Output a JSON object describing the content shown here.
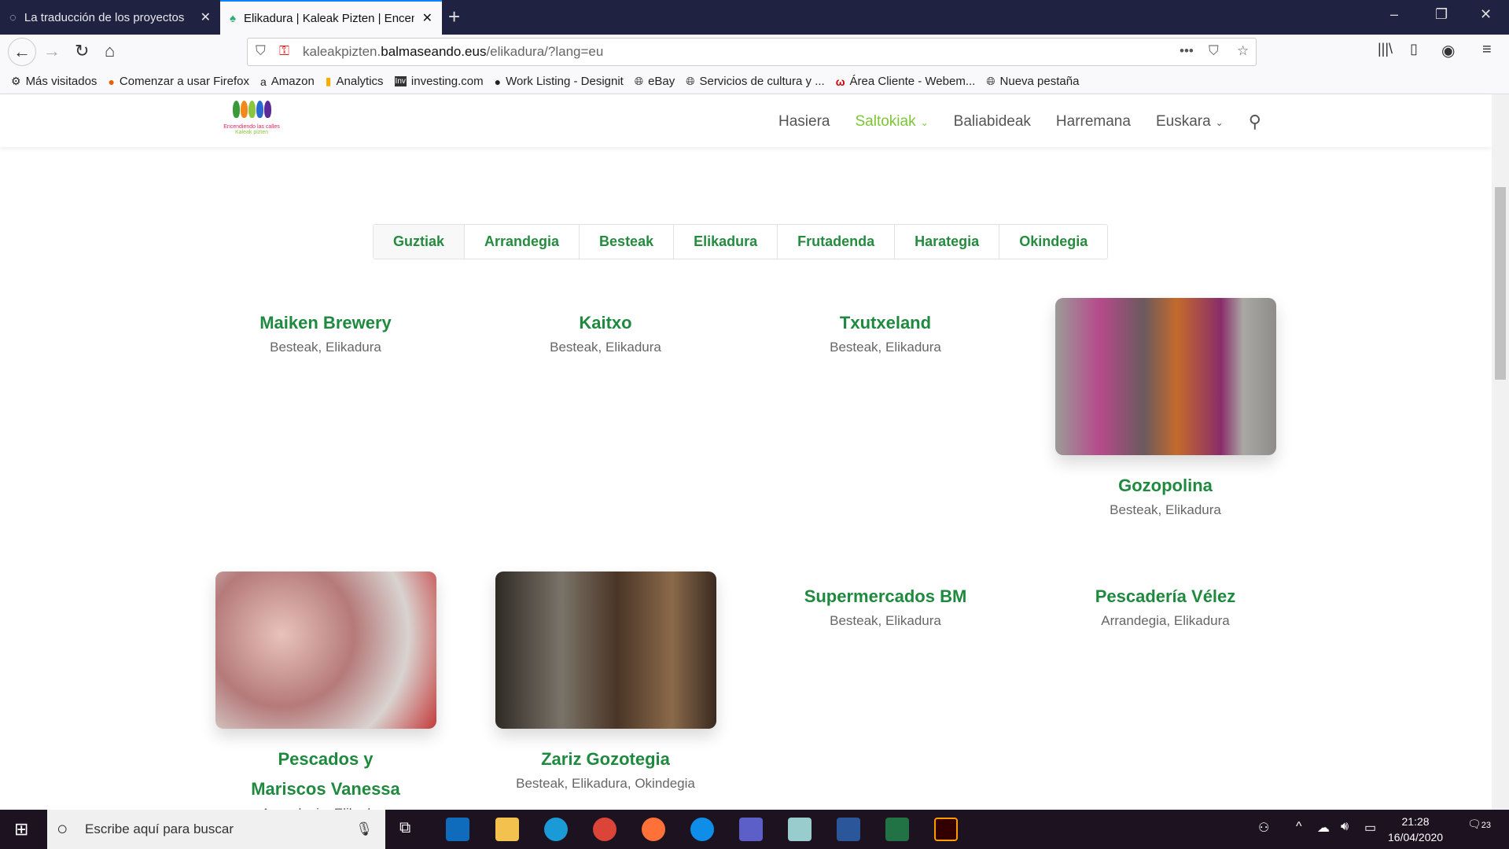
{
  "browser": {
    "tabs": [
      {
        "title": "La traducción de los proyectos"
      },
      {
        "title": "Elikadura | Kaleak Pizten | Encendiendo las calles"
      }
    ],
    "url": {
      "prefix": "kaleakpizten.",
      "domain": "balmaseando.eus",
      "path": "/elikadura/?lang=eu"
    },
    "bookmarks": [
      {
        "label": "Más visitados",
        "icon": "gear-icon"
      },
      {
        "label": "Comenzar a usar Firefox",
        "icon": "firefox-icon"
      },
      {
        "label": "Amazon",
        "icon": "amazon-icon"
      },
      {
        "label": "Analytics",
        "icon": "analytics-icon"
      },
      {
        "label": "investing.com",
        "icon": "investing-icon"
      },
      {
        "label": "Work Listing - Designit",
        "icon": "designit-icon"
      },
      {
        "label": "eBay",
        "icon": "globe-icon"
      },
      {
        "label": "Servicios de cultura y ...",
        "icon": "globe-icon"
      },
      {
        "label": "Área Cliente - Webem...",
        "icon": "webempresa-icon"
      },
      {
        "label": "Nueva pestaña",
        "icon": "globe-icon"
      }
    ]
  },
  "site": {
    "logo": {
      "line1": "Encendiendo las calles",
      "line2": "Kaleak pizten"
    },
    "nav": [
      "Hasiera",
      "Saltokiak",
      "Baliabideak",
      "Harremana",
      "Euskara"
    ],
    "accent": "#7cc636",
    "title_color": "#1f8a3f",
    "filters": [
      "Guztiak",
      "Arrandegia",
      "Besteak",
      "Elikadura",
      "Frutadenda",
      "Harategia",
      "Okindegia"
    ],
    "cards": [
      {
        "title": "Maiken Brewery",
        "cats": "Besteak, Elikadura"
      },
      {
        "title": "Kaitxo",
        "cats": "Besteak, Elikadura"
      },
      {
        "title": "Txutxeland",
        "cats": "Besteak, Elikadura"
      },
      {
        "title": "Gozopolina",
        "cats": "Besteak, Elikadura"
      },
      {
        "title": "Pescados y Mariscos Vanessa",
        "cats": "Arrandegia, Elikadura"
      },
      {
        "title": "Zariz Gozotegia",
        "cats": "Besteak, Elikadura, Okindegia"
      },
      {
        "title": "Supermercados BM",
        "cats": "Besteak, Elikadura"
      },
      {
        "title": "Pescadería Vélez",
        "cats": "Arrandegia, Elikadura"
      }
    ]
  },
  "taskbar": {
    "search_placeholder": "Escribe aquí para buscar",
    "time": "21:28",
    "date": "16/04/2020",
    "notifications": "23"
  }
}
